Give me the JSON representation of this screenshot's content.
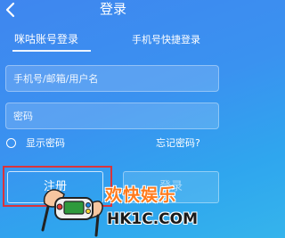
{
  "header": {
    "title": "登录"
  },
  "tabs": {
    "active": "咪咕账号登录",
    "quick": "手机号快捷登录"
  },
  "form": {
    "account_placeholder": "手机号/邮箱/用户名",
    "password_placeholder": "密码",
    "show_password_label": "显示密码",
    "forgot_label": "忘记密码?"
  },
  "actions": {
    "register_label": "注册",
    "login_label": "登录"
  },
  "watermark": {
    "title": "欢快娱乐",
    "url": "HK1C.COM"
  },
  "colors": {
    "accent_highlight": "#d9343c",
    "watermark_orange": "#ff7a1c"
  }
}
